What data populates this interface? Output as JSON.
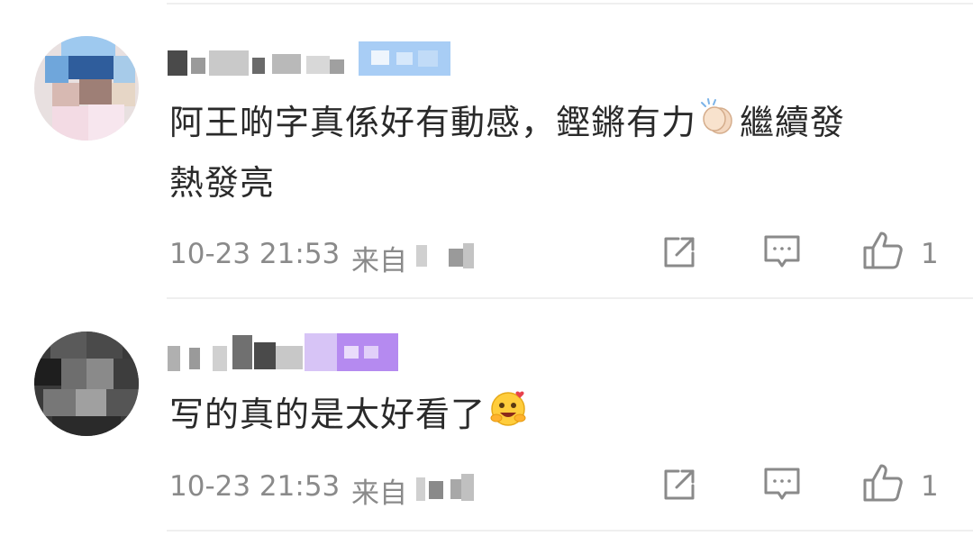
{
  "comments": [
    {
      "text_line1": "阿王啲字真係好有動感，鏗鏘有力",
      "emoji1": "clapping-hands",
      "text_line1b": "繼續發",
      "text_line2": "熱發亮",
      "time": "10-23 21:53",
      "from_label": "来自",
      "likes": "1"
    },
    {
      "text_line1": "写的真的是太好看了",
      "emoji1": "hugging-face",
      "time": "10-23 21:53",
      "from_label": "来自",
      "likes": "1"
    }
  ],
  "icons": {
    "repost": "share-edit-icon",
    "comment": "comment-icon",
    "like": "thumbs-up-icon"
  },
  "colors": {
    "text": "#2a2a2a",
    "meta": "#8a8a8a",
    "badge1": "#9cc3f2",
    "badge2": "#b58af0"
  }
}
